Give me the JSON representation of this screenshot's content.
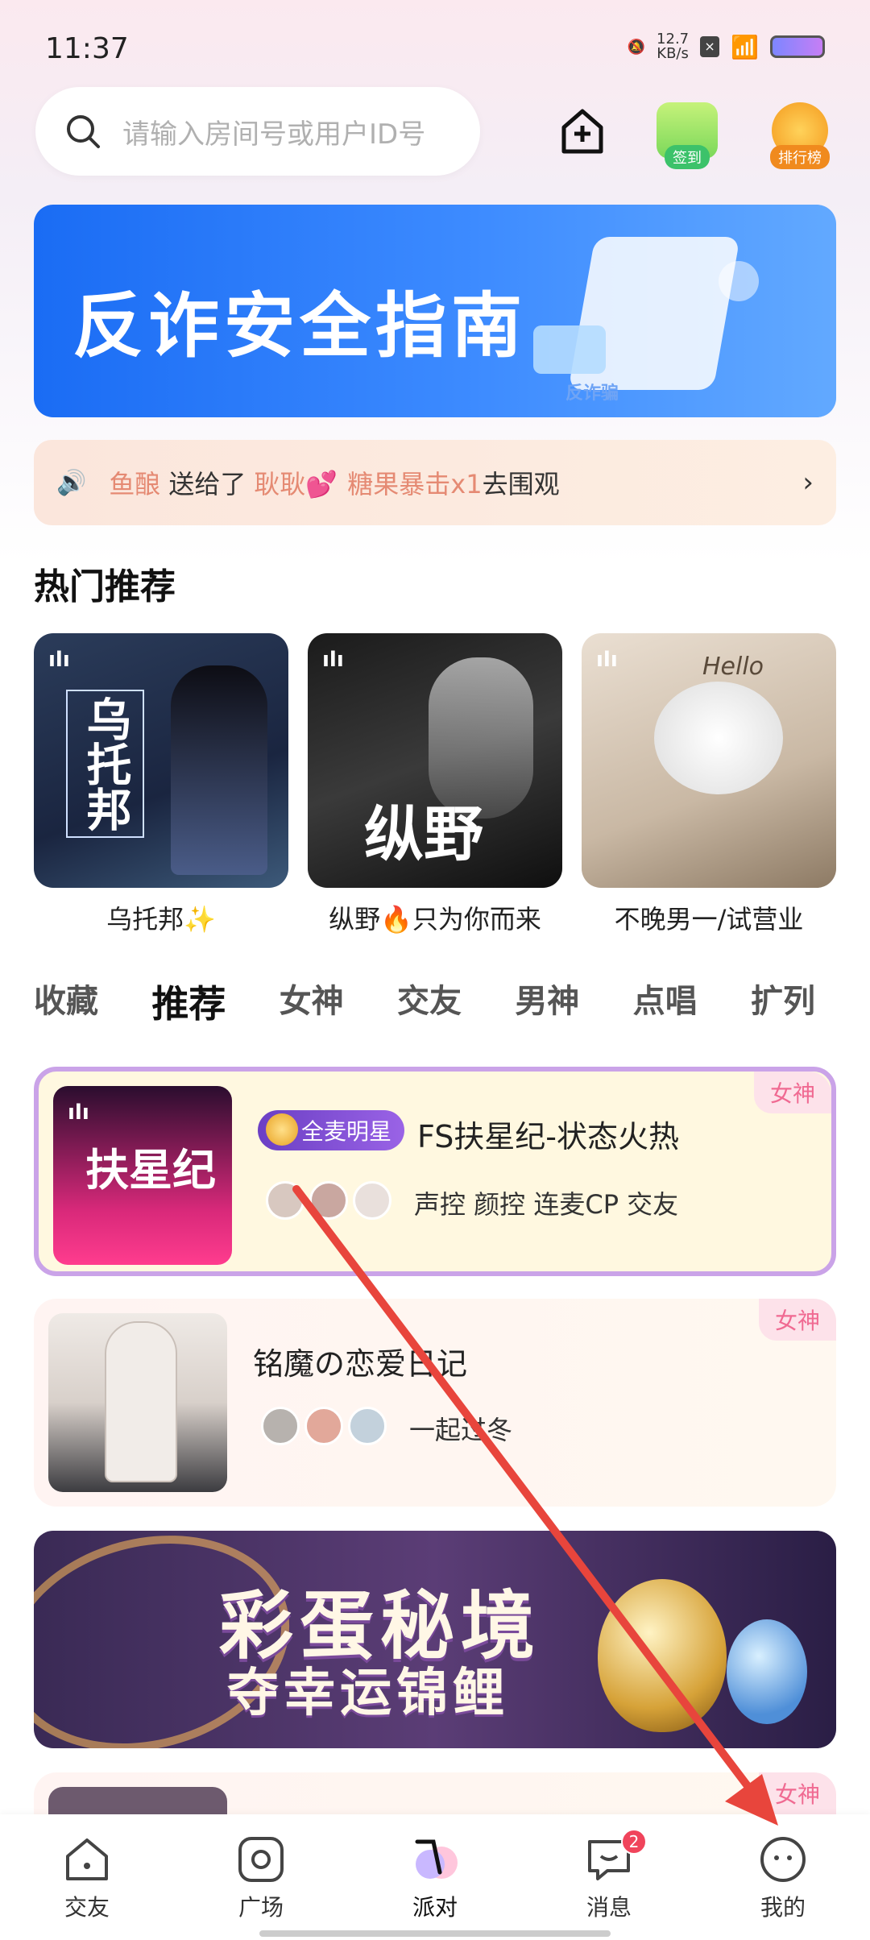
{
  "status": {
    "time": "11:37",
    "net_speed": "12.7",
    "net_unit": "KB/s"
  },
  "search": {
    "placeholder": "请输入房间号或用户ID号"
  },
  "top_actions": {
    "checkin_label": "签到",
    "rank_label": "排行榜"
  },
  "banner": {
    "title": "反诈安全指南",
    "sub": "反诈骗"
  },
  "notice": {
    "user1": "鱼酿",
    "verb": "送给了",
    "user2": "耿耿💕",
    "gift": "糖果暴击x1",
    "action": "去围观"
  },
  "hot": {
    "title": "热门推荐",
    "items": [
      {
        "name": "乌托邦✨",
        "overlay": "乌托邦"
      },
      {
        "name": "纵野🔥只为你而来",
        "overlay": "纵野"
      },
      {
        "name": "不晚男一/试营业",
        "overlay": "Hello"
      }
    ]
  },
  "tabs": [
    "收藏",
    "推荐",
    "女神",
    "交友",
    "男神",
    "点唱",
    "扩列"
  ],
  "rooms": [
    {
      "badge": "全麦明星",
      "title": "FS扶星纪-状态火热",
      "tags": "声控 颜控 连麦CP 交友",
      "tag": "女神",
      "thumb_text": "扶星纪"
    },
    {
      "title": "铭魔の恋爱日记",
      "tags": "一起过冬",
      "tag": "女神"
    }
  ],
  "egg_banner": {
    "line1": "彩蛋秘境",
    "line2": "夺幸运锦鲤"
  },
  "partial_room": {
    "tag": "女神"
  },
  "nav": {
    "items": [
      {
        "label": "交友"
      },
      {
        "label": "广场"
      },
      {
        "label": "派对"
      },
      {
        "label": "消息",
        "badge": "2"
      },
      {
        "label": "我的"
      }
    ]
  },
  "colors": {
    "accent": "#f06a92",
    "banner_blue": "#1a6cf4",
    "arrow": "#e8453c"
  }
}
